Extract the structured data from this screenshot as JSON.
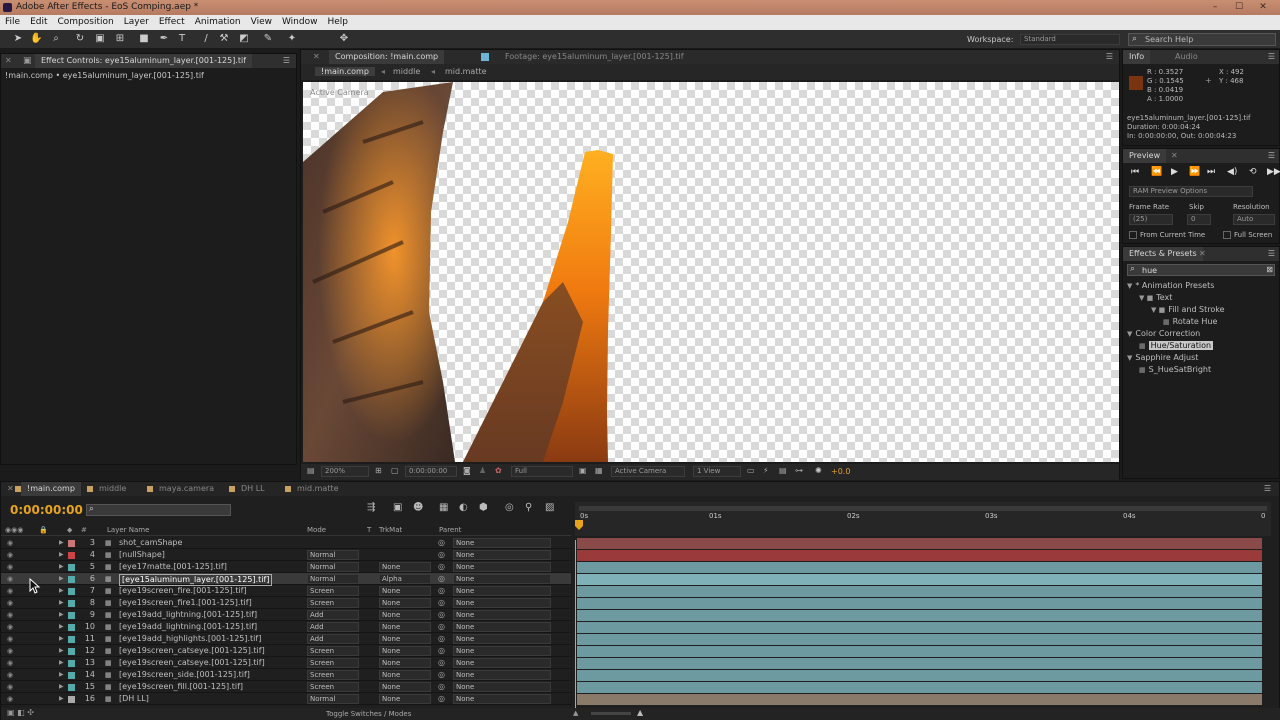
{
  "window": {
    "title": "Adobe After Effects - EoS Comping.aep *"
  },
  "menu": [
    "File",
    "Edit",
    "Composition",
    "Layer",
    "Effect",
    "Animation",
    "View",
    "Window",
    "Help"
  ],
  "workspace": {
    "label": "Workspace:",
    "value": "Standard"
  },
  "search_help": {
    "placeholder": "Search Help"
  },
  "effect_controls": {
    "tab": "Effect Controls: eye15aluminum_layer.[001-125].tif",
    "path": "!main.comp • eye15aluminum_layer.[001-125].tif"
  },
  "composition": {
    "tab": "Composition: !main.comp",
    "footage_tab": "Footage: eye15aluminum_layer.[001-125].tif",
    "breadcrumbs": [
      "!main.comp",
      "middle",
      "mid.matte"
    ],
    "viewer_label": "Active Camera",
    "zoom": "200%",
    "timecode": "0:00:00:00",
    "resolution": "Full",
    "camera": "Active Camera",
    "views": "1 View",
    "exposure": "+0.0"
  },
  "info": {
    "tabs": [
      "Info",
      "Audio"
    ],
    "r": "R : 0.3527",
    "g": "G : 0.1545",
    "b": "B : 0.0419",
    "a": "A : 1.0000",
    "x": "X : 492",
    "y": "Y : 468",
    "swatch": "#7a3410",
    "layer": "eye15aluminum_layer.[001-125].tif",
    "duration": "Duration: 0:00:04:24",
    "inout": "In: 0:00:00:00, Out: 0:00:04:23"
  },
  "preview": {
    "tab": "Preview",
    "options": "RAM Preview Options",
    "frame_rate_label": "Frame Rate",
    "skip_label": "Skip",
    "resolution_label": "Resolution",
    "frame_rate": "(25)",
    "skip": "0",
    "resolution": "Auto",
    "from_current": "From Current Time",
    "full_screen": "Full Screen"
  },
  "effects_presets": {
    "tab": "Effects & Presets",
    "search": "hue",
    "tree": [
      {
        "label": "* Animation Presets",
        "indent": 0,
        "kind": "group"
      },
      {
        "label": "Text",
        "indent": 1,
        "kind": "folder"
      },
      {
        "label": "Fill and Stroke",
        "indent": 2,
        "kind": "folder"
      },
      {
        "label": "Rotate Hue",
        "indent": 3,
        "kind": "preset"
      },
      {
        "label": "Color Correction",
        "indent": 0,
        "kind": "group"
      },
      {
        "label": "Hue/Saturation",
        "indent": 1,
        "kind": "effect",
        "selected": true
      },
      {
        "label": "Sapphire Adjust",
        "indent": 0,
        "kind": "group"
      },
      {
        "label": "S_HueSatBright",
        "indent": 1,
        "kind": "effect"
      }
    ]
  },
  "timeline": {
    "tabs": [
      "!main.comp",
      "middle",
      "maya.camera",
      "DH LL",
      "mid.matte"
    ],
    "timecode": "0:00:00:00",
    "columns": {
      "name": "Layer Name",
      "mode": "Mode",
      "t": "T",
      "trkmat": "TrkMat",
      "parent": "Parent"
    },
    "ruler": [
      "0s",
      "01s",
      "02s",
      "03s",
      "04s",
      "0"
    ],
    "footer": "Toggle Switches / Modes",
    "layers": [
      {
        "num": "3",
        "name": "shot_camShape",
        "mode": "",
        "trkmat": "",
        "parent": "None",
        "color": "#c77",
        "bar": "#8a4a4a"
      },
      {
        "num": "4",
        "name": "[nullShape]",
        "mode": "Normal",
        "trkmat": "",
        "parent": "None",
        "color": "#c44",
        "bar": "#9a3a3a"
      },
      {
        "num": "5",
        "name": "[eye17matte.[001-125].tif]",
        "mode": "Normal",
        "trkmat": "None",
        "parent": "None",
        "color": "#5aa",
        "bar": "#6d9aa0"
      },
      {
        "num": "6",
        "name": "[eye15aluminum_layer.[001-125].tif]",
        "mode": "Normal",
        "trkmat": "Alpha",
        "parent": "None",
        "color": "#5aa",
        "bar": "#7fb2b8",
        "selected": true
      },
      {
        "num": "7",
        "name": "[eye19screen_fire.[001-125].tif]",
        "mode": "Screen",
        "trkmat": "None",
        "parent": "None",
        "color": "#5aa",
        "bar": "#6d9aa0"
      },
      {
        "num": "8",
        "name": "[eye19screen_fire1.[001-125].tif]",
        "mode": "Screen",
        "trkmat": "None",
        "parent": "None",
        "color": "#5aa",
        "bar": "#6d9aa0"
      },
      {
        "num": "9",
        "name": "[eye19add_lightning.[001-125].tif]",
        "mode": "Add",
        "trkmat": "None",
        "parent": "None",
        "color": "#5aa",
        "bar": "#6d9aa0"
      },
      {
        "num": "10",
        "name": "[eye19add_lightning.[001-125].tif]",
        "mode": "Add",
        "trkmat": "None",
        "parent": "None",
        "color": "#5aa",
        "bar": "#6d9aa0"
      },
      {
        "num": "11",
        "name": "[eye19add_highlights.[001-125].tif]",
        "mode": "Add",
        "trkmat": "None",
        "parent": "None",
        "color": "#5aa",
        "bar": "#6d9aa0"
      },
      {
        "num": "12",
        "name": "[eye19screen_catseye.[001-125].tif]",
        "mode": "Screen",
        "trkmat": "None",
        "parent": "None",
        "color": "#5aa",
        "bar": "#6d9aa0"
      },
      {
        "num": "13",
        "name": "[eye19screen_catseye.[001-125].tif]",
        "mode": "Screen",
        "trkmat": "None",
        "parent": "None",
        "color": "#5aa",
        "bar": "#6d9aa0"
      },
      {
        "num": "14",
        "name": "[eye19screen_side.[001-125].tif]",
        "mode": "Screen",
        "trkmat": "None",
        "parent": "None",
        "color": "#5aa",
        "bar": "#6d9aa0"
      },
      {
        "num": "15",
        "name": "[eye19screen_fill.[001-125].tif]",
        "mode": "Screen",
        "trkmat": "None",
        "parent": "None",
        "color": "#5aa",
        "bar": "#6d9aa0"
      },
      {
        "num": "16",
        "name": "[DH LL]",
        "mode": "Normal",
        "trkmat": "None",
        "parent": "None",
        "color": "#aaa",
        "bar": "#8a7a6a"
      }
    ]
  }
}
